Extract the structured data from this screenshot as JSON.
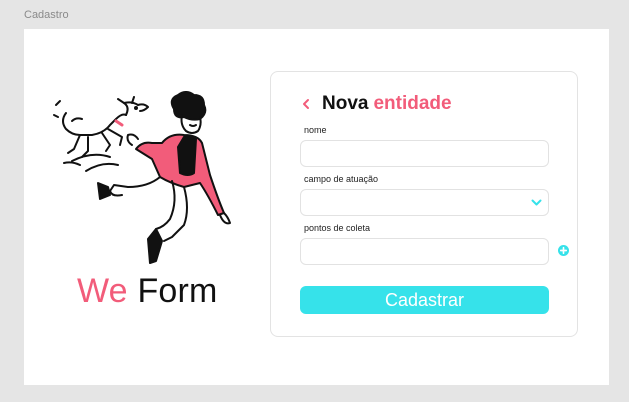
{
  "frame": {
    "label": "Cadastro"
  },
  "brand": {
    "accent": "We",
    "rest": " Form"
  },
  "form": {
    "title_part1": "Nova",
    "title_part2": "entidade",
    "fields": [
      {
        "label": "nome",
        "value": ""
      },
      {
        "label": "campo de atuação",
        "value": ""
      },
      {
        "label": "pontos de coleta",
        "value": ""
      }
    ],
    "submit_label": "Cadastrar"
  },
  "colors": {
    "accent_pink": "#f25c7a",
    "accent_cyan": "#36e2ea",
    "background": "#e5e5e5"
  },
  "icons": {
    "back": "chevron-left-icon",
    "select": "chevron-down-icon",
    "add": "plus-circle-icon",
    "illustration": "man-and-dog-illustration"
  }
}
